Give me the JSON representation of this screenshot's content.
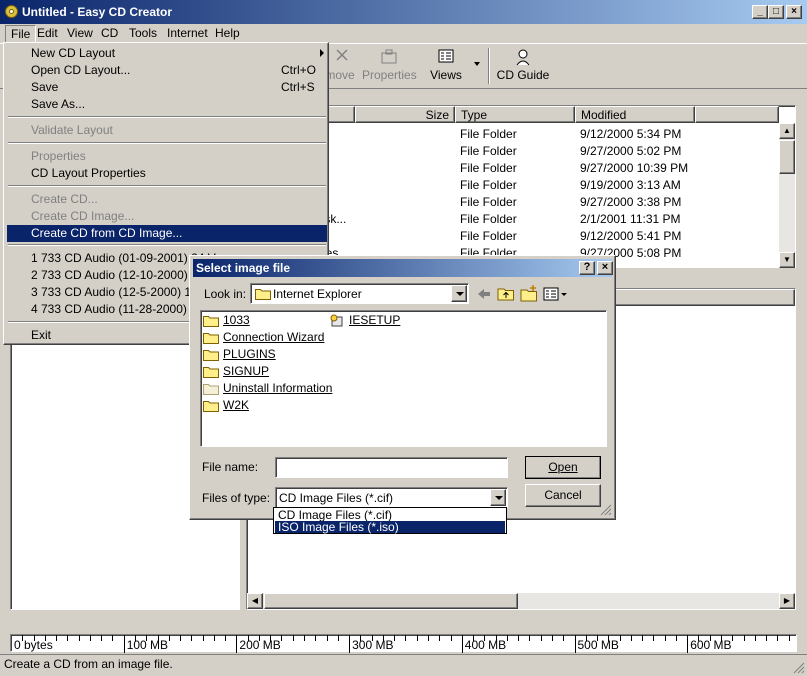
{
  "window": {
    "title": "Untitled - Easy CD Creator"
  },
  "menubar": [
    "File",
    "Edit",
    "View",
    "CD",
    "Tools",
    "Internet",
    "Help"
  ],
  "toolbar": {
    "remove": "move",
    "properties": "Properties",
    "views": "Views",
    "cd_guide": "CD Guide"
  },
  "upper_list": {
    "columns": [
      "Size",
      "Type",
      "Modified"
    ],
    "rows": [
      {
        "name": "",
        "type": "File Folder",
        "modified": "9/12/2000 5:34 PM"
      },
      {
        "name": "",
        "type": "File Folder",
        "modified": "9/27/2000 5:02 PM"
      },
      {
        "name": "",
        "type": "File Folder",
        "modified": "9/27/2000 10:39 PM"
      },
      {
        "name": "",
        "type": "File Folder",
        "modified": "9/19/2000 3:13 AM"
      },
      {
        "name": "",
        "type": "File Folder",
        "modified": "9/27/2000 3:38 PM"
      },
      {
        "name": "Disk...",
        "type": "File Folder",
        "modified": "2/1/2001 11:31 PM"
      },
      {
        "name": "",
        "type": "File Folder",
        "modified": "9/12/2000 5:41 PM"
      },
      {
        "name": "Files",
        "type": "File Folder",
        "modified": "9/27/2000 5:08 PM"
      }
    ]
  },
  "file_menu": {
    "items": [
      {
        "label": "New CD Layout",
        "shortcut": "",
        "disabled": false,
        "submenu": true
      },
      {
        "label": "Open CD Layout...",
        "shortcut": "Ctrl+O",
        "disabled": false
      },
      {
        "label": "Save",
        "shortcut": "Ctrl+S",
        "disabled": false
      },
      {
        "label": "Save As...",
        "shortcut": "",
        "disabled": false
      },
      {
        "label": "Validate Layout",
        "shortcut": "",
        "disabled": true
      },
      {
        "label": "Properties",
        "shortcut": "",
        "disabled": true
      },
      {
        "label": "CD Layout Properties",
        "shortcut": "",
        "disabled": false
      },
      {
        "label": "Create CD...",
        "shortcut": "",
        "disabled": true
      },
      {
        "label": "Create CD Image...",
        "shortcut": "",
        "disabled": true
      },
      {
        "label": "Create CD from CD Image...",
        "shortcut": "",
        "disabled": false,
        "highlighted": true
      },
      {
        "label": "1 733 CD Audio (01-09-2001) 24 V",
        "shortcut": "",
        "disabled": false
      },
      {
        "label": "2 733 CD Audio (12-10-2000) 21 D",
        "shortcut": "",
        "disabled": false
      },
      {
        "label": "3 733 CD Audio (12-5-2000) 19 Tra",
        "shortcut": "",
        "disabled": false
      },
      {
        "label": "4 733 CD Audio (11-28-2000) 18 T",
        "shortcut": "",
        "disabled": false
      },
      {
        "label": "Exit",
        "shortcut": "",
        "disabled": false
      }
    ]
  },
  "dialog": {
    "title": "Select image file",
    "look_in_label": "Look in:",
    "look_in_value": "Internet Explorer",
    "files": [
      "1033",
      "Connection Wizard",
      "PLUGINS",
      "SIGNUP",
      "Uninstall Information",
      "W2K",
      "IESETUP"
    ],
    "file_name_label": "File name:",
    "file_name_value": "",
    "files_of_type_label": "Files of type:",
    "files_of_type_value": "CD Image Files (*.cif)",
    "type_options": [
      "CD Image Files (*.cif)",
      "ISO Image Files (*.iso)"
    ],
    "open_button": "Open",
    "cancel_button": "Cancel"
  },
  "ruler": {
    "labels": [
      "0 bytes",
      "100 MB",
      "200 MB",
      "300 MB",
      "400 MB",
      "500 MB",
      "600 MB"
    ]
  },
  "status": {
    "text": "Create a CD from an image file."
  },
  "colors": {
    "title_active": "#0a246a",
    "face": "#d4d0c8",
    "highlight": "#0a246a"
  }
}
